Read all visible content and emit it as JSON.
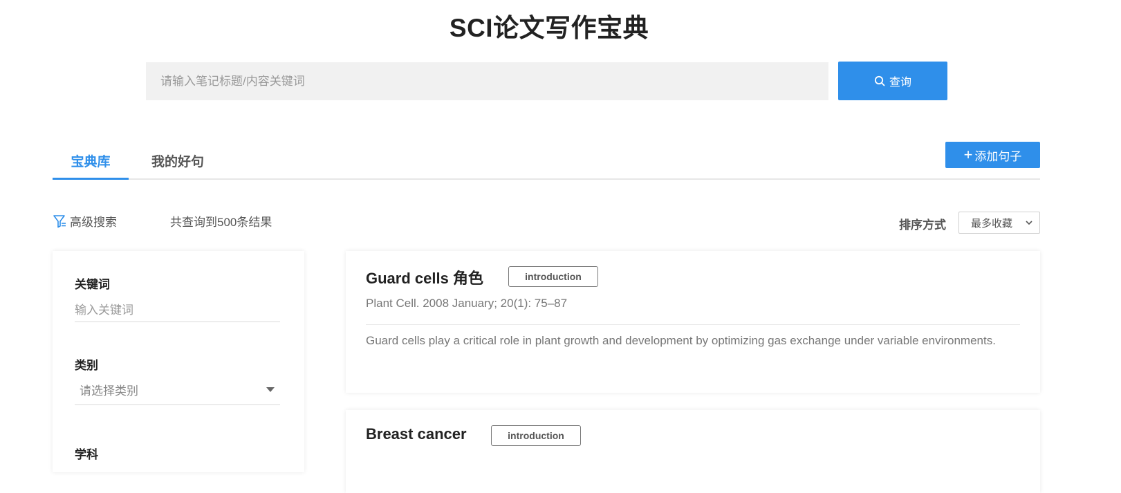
{
  "header": {
    "title": "SCI论文写作宝典",
    "search_placeholder": "请输入笔记标题/内容关键词",
    "search_button": "查询"
  },
  "tabs": [
    {
      "label": "宝典库",
      "active": true
    },
    {
      "label": "我的好句",
      "active": false
    }
  ],
  "add_button": {
    "label": "添加句子"
  },
  "toolbar": {
    "advanced_search": "高级搜索",
    "result_count": "共查询到500条结果",
    "sort_label": "排序方式",
    "sort_value": "最多收藏"
  },
  "filters": {
    "keyword_label": "关键词",
    "keyword_placeholder": "输入关键词",
    "category_label": "类别",
    "category_placeholder": "请选择类别",
    "subject_label": "学科"
  },
  "cards": [
    {
      "title": "Guard cells 角色",
      "tag": "introduction",
      "source": "Plant Cell. 2008 January; 20(1): 75–87",
      "text": "Guard cells play a critical role in plant growth and development by optimizing gas exchange under variable environments."
    },
    {
      "title": "Breast cancer",
      "tag": "introduction"
    }
  ],
  "colors": {
    "accent": "#2f8fea",
    "search_bg": "#f1f1f1"
  }
}
